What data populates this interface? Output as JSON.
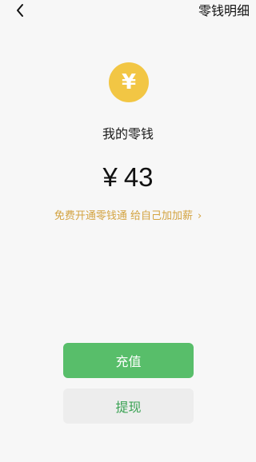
{
  "nav": {
    "back_icon": "chevron-left-icon",
    "right_title": "零钱明细"
  },
  "wallet": {
    "coin_symbol": "¥",
    "coin_color": "#f2c644",
    "title": "我的零钱",
    "currency": "¥",
    "amount": "43",
    "promo_text": "免费开通零钱通 给自己加加薪",
    "promo_chevron": "›",
    "promo_color": "#d3a341"
  },
  "actions": {
    "recharge_label": "充值",
    "withdraw_label": "提现",
    "primary_color": "#58be6a"
  }
}
